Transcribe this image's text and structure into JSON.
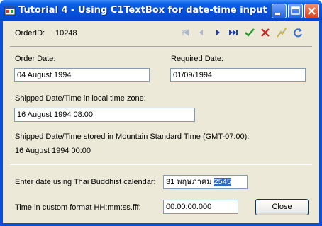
{
  "window": {
    "title": "Tutorial 4 - Using C1TextBox for date-time input",
    "controls": {
      "minimize": "minimize",
      "maximize": "maximize",
      "close": "close"
    }
  },
  "header": {
    "order_id_label": "OrderID:",
    "order_id_value": "10248",
    "navigator_icons": [
      "first-record-icon",
      "previous-record-icon",
      "next-record-icon",
      "last-record-icon",
      "apply-edit-icon",
      "cancel-edit-icon",
      "update-data-icon",
      "refresh-data-icon"
    ]
  },
  "form": {
    "order_date_label": "Order Date:",
    "order_date_value": "04 August 1994",
    "required_date_label": "Required Date:",
    "required_date_value": "01/09/1994",
    "shipped_local_label": "Shipped Date/Time in local time zone:",
    "shipped_local_value": "16 August 1994 08:00",
    "shipped_mst_label": "Shipped Date/Time stored in Mountain Standard Time (GMT-07:00):",
    "shipped_mst_value": "16 August 1994 00:00",
    "thai_label": "Enter date using Thai Buddhist calendar:",
    "thai_value_prefix": "31 พฤษภาคม ",
    "thai_value_selected": "2545",
    "custom_label": "Time in custom format HH:mm:ss.fff:",
    "custom_value": "00:00:00.000",
    "close_button": "Close"
  },
  "colors": {
    "title_bar": "#0a4fd8",
    "client": "#ece9d8",
    "selection": "#316ac5"
  }
}
